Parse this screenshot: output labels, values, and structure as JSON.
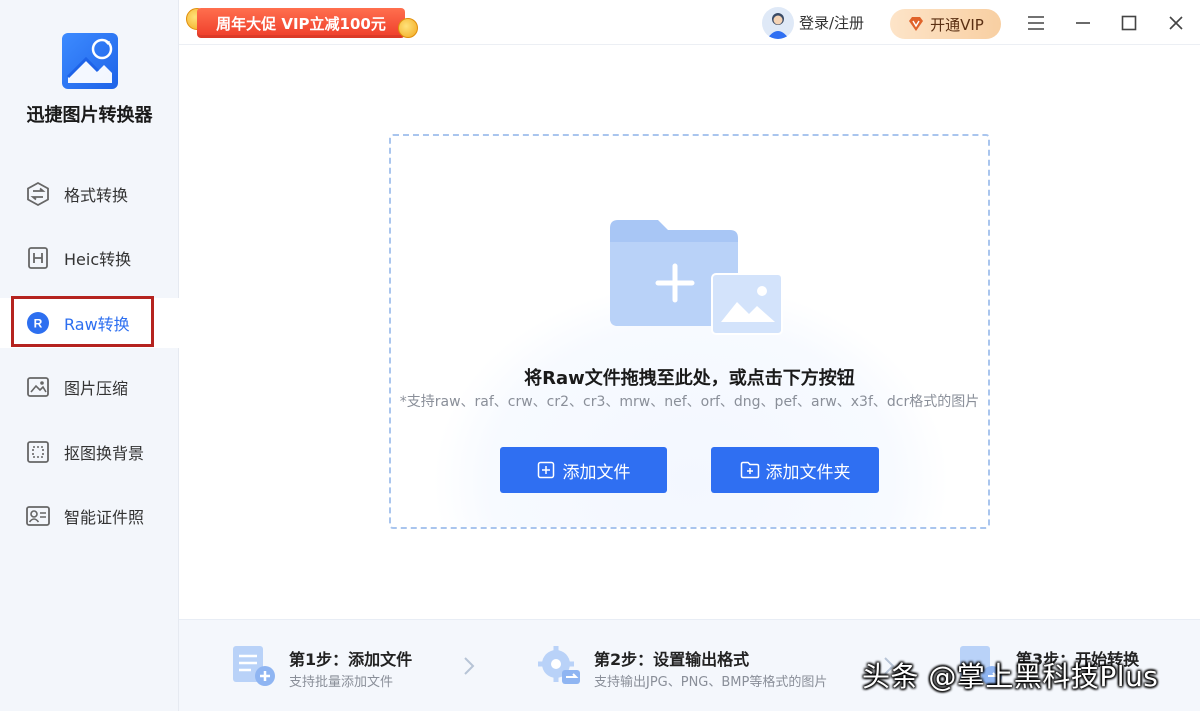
{
  "app": {
    "name": "迅捷图片转换器"
  },
  "sidebar": {
    "items": [
      {
        "label": "格式转换",
        "icon": "format-convert-icon"
      },
      {
        "label": "Heic转换",
        "icon": "heic-icon"
      },
      {
        "label": "Raw转换",
        "icon": "raw-icon",
        "active": true
      },
      {
        "label": "图片压缩",
        "icon": "image-compress-icon"
      },
      {
        "label": "抠图换背景",
        "icon": "cutout-icon"
      },
      {
        "label": "智能证件照",
        "icon": "id-photo-icon"
      }
    ]
  },
  "topbar": {
    "promo": "周年大促 VIP立减100元",
    "login": "登录/注册",
    "vip": "开通VIP"
  },
  "dropzone": {
    "title": "将Raw文件拖拽至此处，或点击下方按钮",
    "hint": "*支持raw、raf、crw、cr2、cr3、mrw、nef、orf、dng、pef、arw、x3f、dcr格式的图片",
    "add_file": "添加文件",
    "add_folder": "添加文件夹"
  },
  "steps": [
    {
      "title": "第1步：添加文件",
      "desc": "支持批量添加文件"
    },
    {
      "title": "第2步：设置输出格式",
      "desc": "支持输出JPG、PNG、BMP等格式的图片"
    },
    {
      "title": "第3步：开始转换",
      "desc": ""
    }
  ],
  "watermark": "头条 @掌上黑科技Plus",
  "colors": {
    "accent": "#2f6ff2",
    "sidebar_bg": "#f3f6fb",
    "highlight_border": "#b5231f",
    "promo": "#ee3d2a"
  }
}
